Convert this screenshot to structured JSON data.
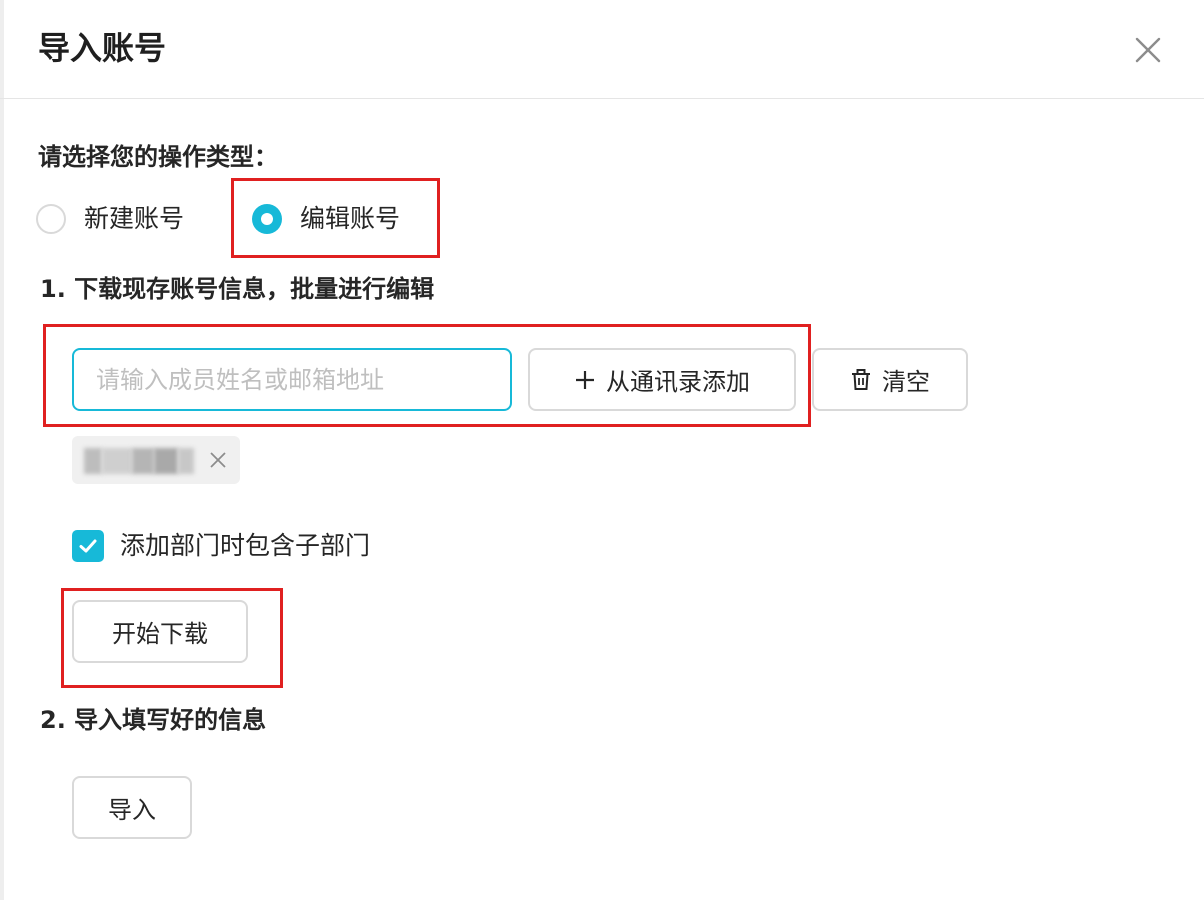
{
  "dialog": {
    "title": "导入账号",
    "close_icon": "close-icon"
  },
  "operation": {
    "prompt": "请选择您的操作类型：",
    "options": [
      {
        "label": "新建账号",
        "checked": false
      },
      {
        "label": "编辑账号",
        "checked": true
      }
    ]
  },
  "step1": {
    "title": "1. 下载现存账号信息，批量进行编辑",
    "search_placeholder": "请输入成员姓名或邮箱地址",
    "add_button_label": "从通讯录添加",
    "add_icon": "plus-icon",
    "clear_button_label": "清空",
    "clear_icon": "trash-icon",
    "include_subdepartments_label": "添加部门时包含子部门",
    "include_subdepartments_checked": true,
    "download_button_label": "开始下载"
  },
  "step2": {
    "title": "2. 导入填写好的信息",
    "import_button_label": "导入"
  },
  "colors": {
    "accent": "#17b9d8",
    "highlight": "#e02020",
    "border": "#d9d9d9"
  }
}
